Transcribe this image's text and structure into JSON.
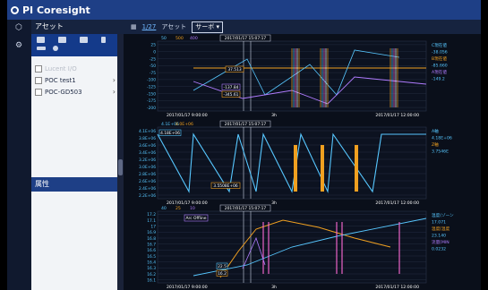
{
  "app": {
    "title": "PI Coresight"
  },
  "sidebar": {
    "heading": "アセット",
    "items": [
      {
        "label": "Lucent I/O",
        "checked": false
      },
      {
        "label": "POC test1",
        "checked": false
      },
      {
        "label": "POC-GD503",
        "checked": false
      }
    ],
    "properties_label": "属性"
  },
  "toolbar": {
    "value_label": "1/27",
    "asset_label": "アセット",
    "selector_value": "サーボ"
  },
  "colors": {
    "cyan": "#57c7ff",
    "orange": "#f0a020",
    "purple": "#b07cff",
    "magenta": "#ff6bd6",
    "white": "#ffffff",
    "bg": "#0a0f1a",
    "grid": "#2a3348",
    "brand": "#1e3f86"
  },
  "charts": {
    "chart1": {
      "header_values": [
        "50",
        "500",
        "400"
      ],
      "cursor_time": "2017/01/17 15:07:17",
      "left_axis_labels": [
        "25",
        "0",
        "-25",
        "-50",
        "-75",
        "-100",
        "-125",
        "-150",
        "-175",
        "-200"
      ],
      "labels": {
        "cursor_value": "37.513",
        "min_value": "-137.84",
        "min_value2": "-345.61"
      },
      "right_labels": [
        "C現在値",
        "-38.056",
        "B現在値",
        "-85.660",
        "A現在値",
        "-149.2"
      ],
      "x_ticks": [
        "2017/01/17 9:00:00",
        "3h",
        "2017/01/17 12:00:00"
      ]
    },
    "chart2": {
      "header_values": [
        "4.1E+06",
        "8.0E+06"
      ],
      "cursor_time": "2017/01/17 15:07:17",
      "left_axis_labels": [
        "4.1E+06",
        "3.8E+06",
        "3.6E+06",
        "3.4E+06",
        "3.2E+06",
        "3.0E+06",
        "2.8E+06",
        "2.6E+06",
        "2.4E+06",
        "2.2E+06"
      ],
      "labels": {
        "cursor_value": "4.18E+06",
        "bottom_value": "3.5508E+06"
      },
      "right_labels": [
        "A軸",
        "4.18E+06",
        "Z軸",
        "3.7546E"
      ],
      "x_ticks": [
        "2017/01/17 9:00:00",
        "3h",
        "2017/01/17 12:00:00"
      ]
    },
    "chart3": {
      "header_values": [
        "40",
        "25",
        "10"
      ],
      "cursor_time": "2017/01/17 15:07:17",
      "left_axis_labels": [
        "17.2",
        "17.1",
        "17",
        "16.9",
        "16.8",
        "16.7",
        "16.6",
        "16.5",
        "16.4",
        "16.3",
        "16.2",
        "16.1"
      ],
      "labels": {
        "a": "22.5",
        "b": "16.2",
        "c": "Arc Offline"
      },
      "right_labels": [
        "温度(ゾーン",
        "17.071",
        "温度[温度",
        "23.140",
        "流量[MIN",
        "0.0232"
      ],
      "x_ticks": [
        "2017/01/17 9:00:00",
        "3h",
        "2017/01/17 12:00:00"
      ]
    }
  }
}
